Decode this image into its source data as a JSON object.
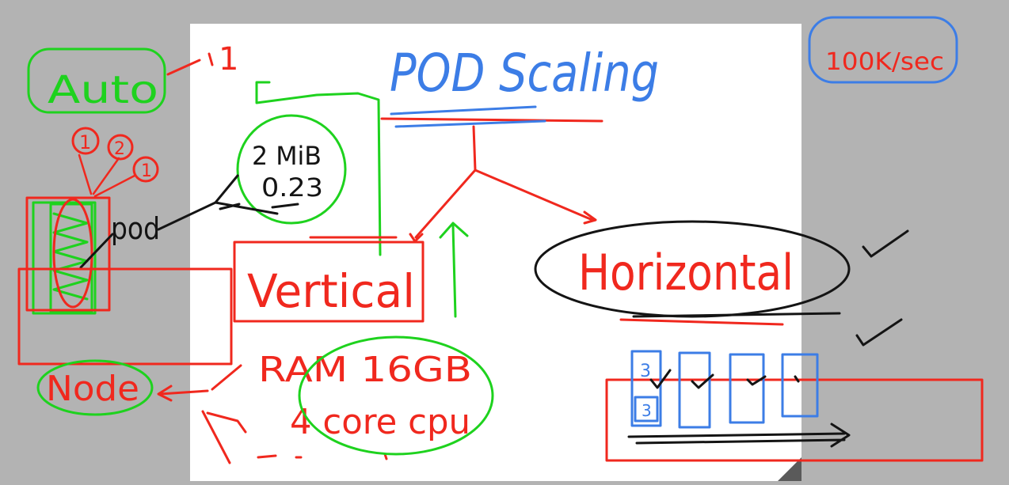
{
  "colors": {
    "canvas_bg": "#b3b3b3",
    "page": "#ffffff",
    "red": "#f0281e",
    "green": "#1ed21e",
    "blue": "#3c7de6",
    "black": "#141414"
  },
  "title": "POD Scaling",
  "rate": "100K/sec",
  "auto": "Auto",
  "auto_one": "1",
  "pod": "pod",
  "node": "Node",
  "circled_numbers": [
    "1",
    "2",
    "1"
  ],
  "metrics": {
    "line1": "2 MiB",
    "line2": "0.23"
  },
  "vertical": "Vertical",
  "horizontal": "Horizontal",
  "ram": "RAM 16GB",
  "cpu": "4 core cpu",
  "node_pods": [
    "3",
    "3"
  ],
  "icons": [
    "checkmark-icon",
    "arrow-icon",
    "page-curl-icon"
  ]
}
